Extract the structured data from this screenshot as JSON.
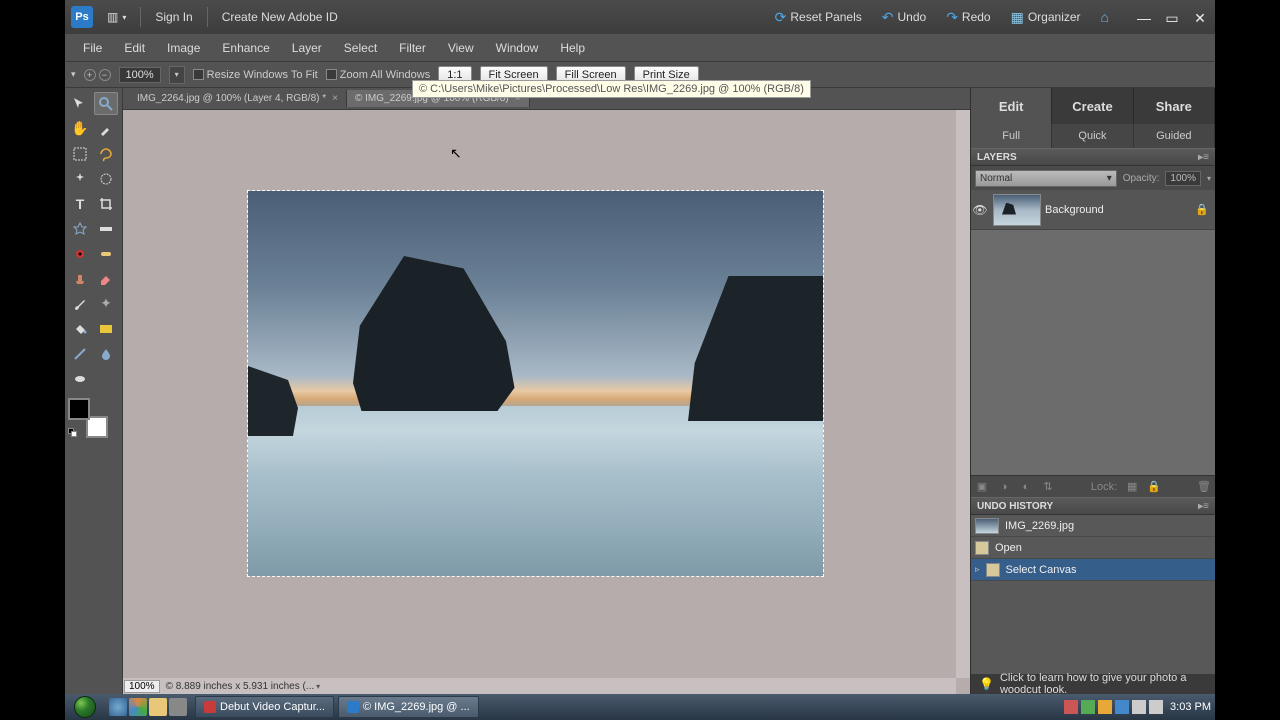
{
  "titlebar": {
    "signIn": "Sign In",
    "createId": "Create New Adobe ID",
    "resetPanels": "Reset Panels",
    "undo": "Undo",
    "redo": "Redo",
    "organizer": "Organizer"
  },
  "menubar": [
    "File",
    "Edit",
    "Image",
    "Enhance",
    "Layer",
    "Select",
    "Filter",
    "View",
    "Window",
    "Help"
  ],
  "optbar": {
    "zoom": "100%",
    "resize": "Resize Windows To Fit",
    "zoomAll": "Zoom All Windows",
    "b1": "1:1",
    "b2": "Fit Screen",
    "b3": "Fill Screen",
    "b4": "Print Size",
    "tooltip": "© C:\\Users\\Mike\\Pictures\\Processed\\Low Res\\IMG_2269.jpg @ 100% (RGB/8)"
  },
  "docTabs": [
    {
      "label": "IMG_2264.jpg @ 100% (Layer 4, RGB/8) *",
      "active": false
    },
    {
      "label": "© IMG_2269.jpg @ 100% (RGB/8)",
      "active": true
    }
  ],
  "statusbar": {
    "zoom": "100%",
    "info": "© 8.889 inches x 5.931 inches (..."
  },
  "modeTabs": [
    "Edit",
    "Create",
    "Share"
  ],
  "subTabs": [
    "Full",
    "Quick",
    "Guided"
  ],
  "layers": {
    "title": "LAYERS",
    "blend": "Normal",
    "opacityLabel": "Opacity:",
    "opacityVal": "100%",
    "rows": [
      {
        "name": "Background",
        "locked": true
      }
    ],
    "lockLabel": "Lock:"
  },
  "history": {
    "title": "UNDO HISTORY",
    "rows": [
      {
        "label": "IMG_2269.jpg",
        "type": "doc"
      },
      {
        "label": "Open",
        "type": "step"
      },
      {
        "label": "Select Canvas",
        "type": "step",
        "active": true
      }
    ]
  },
  "tip": "Click to learn how to give your photo a woodcut look.",
  "taskbar": {
    "tasks": [
      {
        "label": "Debut Video Captur...",
        "color": "#c93a3a"
      },
      {
        "label": "© IMG_2269.jpg @ ...",
        "color": "#2b7bc9",
        "active": true
      }
    ],
    "time": "3:03 PM"
  }
}
